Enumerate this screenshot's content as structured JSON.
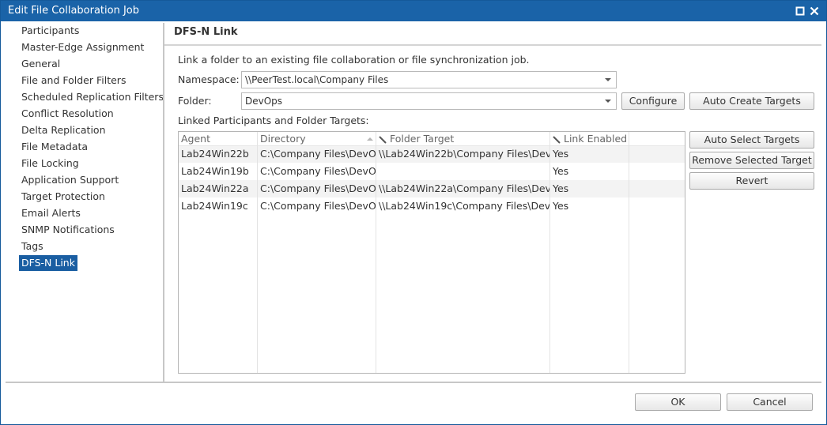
{
  "window": {
    "title": "Edit File Collaboration Job",
    "maximize_icon": "maximize-icon",
    "close_icon": "close-icon"
  },
  "nav": {
    "items": [
      {
        "label": "Participants"
      },
      {
        "label": "Master-Edge Assignment"
      },
      {
        "label": "General"
      },
      {
        "label": "File and Folder Filters"
      },
      {
        "label": "Scheduled Replication Filters"
      },
      {
        "label": "Conflict Resolution"
      },
      {
        "label": "Delta Replication"
      },
      {
        "label": "File Metadata"
      },
      {
        "label": "File Locking"
      },
      {
        "label": "Application Support"
      },
      {
        "label": "Target Protection"
      },
      {
        "label": "Email Alerts"
      },
      {
        "label": "SNMP Notifications"
      },
      {
        "label": "Tags"
      },
      {
        "label": "DFS-N Link"
      }
    ],
    "selected": "DFS-N Link"
  },
  "panel": {
    "title": "DFS-N Link",
    "description": "Link a folder to an existing file collaboration or file synchronization job.",
    "namespace": {
      "label": "Namespace:",
      "value": "\\\\PeerTest.local\\Company Files"
    },
    "folder": {
      "label": "Folder:",
      "value": "DevOps"
    },
    "configure_button": "Configure",
    "auto_create_button": "Auto Create Targets",
    "table_label": "Linked Participants and Folder Targets:",
    "table": {
      "columns": [
        "Agent",
        "Directory",
        "Folder Target",
        "Link Enabled"
      ],
      "sort_column": "Directory",
      "editable_icon": "pencil-icon",
      "rows": [
        {
          "agent": "Lab24Win22b",
          "directory": "C:\\Company Files\\DevO",
          "target": "\\\\Lab24Win22b\\Company Files\\Dev",
          "enabled": "Yes"
        },
        {
          "agent": "Lab24Win19b",
          "directory": "C:\\Company Files\\DevO",
          "target": "",
          "enabled": "Yes"
        },
        {
          "agent": "Lab24Win22a",
          "directory": "C:\\Company Files\\DevO",
          "target": "\\\\Lab24Win22a\\Company Files\\Dev",
          "enabled": "Yes"
        },
        {
          "agent": "Lab24Win19c",
          "directory": "C:\\Company Files\\DevO",
          "target": "\\\\Lab24Win19c\\Company Files\\Dev",
          "enabled": "Yes"
        }
      ]
    },
    "auto_select_button": "Auto Select Targets",
    "remove_button": "Remove Selected Target",
    "revert_button": "Revert"
  },
  "footer": {
    "ok": "OK",
    "cancel": "Cancel"
  },
  "colors": {
    "title_bar": "#1a63a8",
    "selection": "#1a5ea2"
  }
}
